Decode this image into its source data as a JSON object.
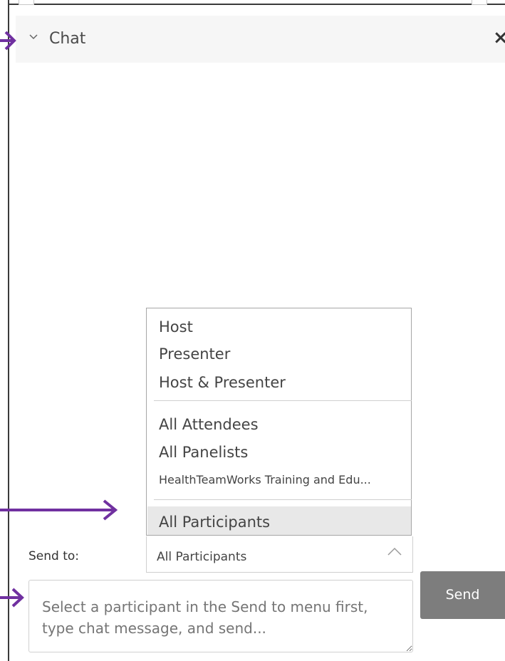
{
  "header": {
    "title": "Chat"
  },
  "menu": {
    "group1": [
      "Host",
      "Presenter",
      "Host & Presenter"
    ],
    "group2": [
      "All Attendees",
      "All Panelists",
      "HealthTeamWorks Training and Edu..."
    ],
    "selected": "All Participants"
  },
  "send_to": {
    "label": "Send to:",
    "value": "All Participants"
  },
  "message": {
    "placeholder": "Select a participant in the Send to menu first, type chat message, and send..."
  },
  "send_button": {
    "label": "Send"
  },
  "colors": {
    "annotation_arrow": "#7030a0",
    "send_button_bg": "#7d7d7d",
    "menu_selected_bg": "#e8e8e8"
  }
}
